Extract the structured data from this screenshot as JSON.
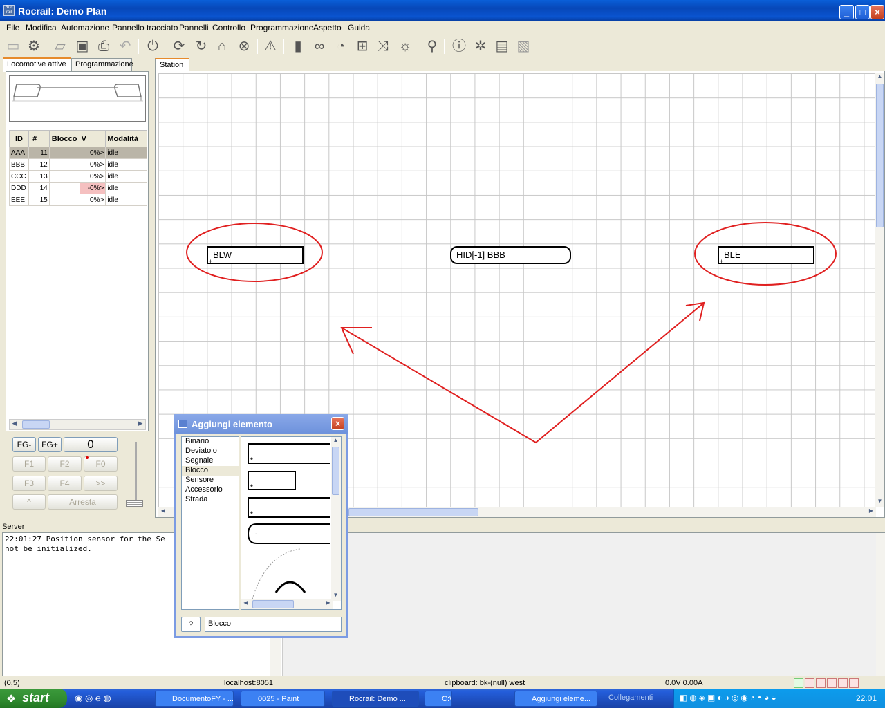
{
  "window": {
    "title": "Rocrail: Demo Plan",
    "app_icon_text": "Roc rail"
  },
  "menu": [
    "File",
    "Modifica",
    "Automazione",
    "Pannello tracciato",
    "Pannelli",
    "Controllo",
    "Programmazione",
    "Aspetto",
    "Guida"
  ],
  "left_tabs": {
    "active": "Locomotive attive",
    "other": "Programmazione"
  },
  "loco_table": {
    "headers": [
      "ID",
      "#__",
      "Blocco",
      "V___",
      "Modalità"
    ],
    "rows": [
      {
        "id": "AAA",
        "num": "11",
        "block": "",
        "v": "0%>",
        "mode": "idle"
      },
      {
        "id": "BBB",
        "num": "12",
        "block": "",
        "v": "0%>",
        "mode": "idle"
      },
      {
        "id": "CCC",
        "num": "13",
        "block": "",
        "v": "0%>",
        "mode": "idle"
      },
      {
        "id": "DDD",
        "num": "14",
        "block": "",
        "v": "-0%>",
        "mode": "idle"
      },
      {
        "id": "EEE",
        "num": "15",
        "block": "",
        "v": "0%>",
        "mode": "idle"
      }
    ]
  },
  "controls": {
    "fg_minus": "FG-",
    "fg_plus": "FG+",
    "speed": "0",
    "f1": "F1",
    "f2": "F2",
    "f0": "F0",
    "f3": "F3",
    "f4": "F4",
    "more": ">>",
    "dir": "^",
    "stop": "Arresta"
  },
  "station_tab": "Station",
  "blocks": {
    "left": "BLW",
    "center": "HID[-1] BBB",
    "right": "BLE"
  },
  "server": {
    "label": "Server",
    "log_line1": "22:01:27 Position sensor for the Se",
    "log_line2": "not be initialized."
  },
  "status": {
    "coords": "(0,5)",
    "host": "localhost:8051",
    "clipboard": "clipboard: bk-(null) west",
    "power": "0.0V 0.00A"
  },
  "taskbar": {
    "start": "start",
    "tasks": [
      "DocumentoFY - ...",
      "0025 - Paint",
      "Rocrail: Demo ...",
      "C:\\",
      "Aggiungi eleme..."
    ],
    "links": "Collegamenti",
    "clock": "22.01"
  },
  "dialog": {
    "title": "Aggiungi elemento",
    "items": [
      "Binario",
      "Deviatoio",
      "Segnale",
      "Blocco",
      "Sensore",
      "Accessorio",
      "Strada"
    ],
    "selected": "Blocco",
    "help": "?",
    "field": "Blocco"
  },
  "colors": {
    "annotation": "#e02020",
    "title_bar": "#0a54d0",
    "tab_highlight": "#e68b2c"
  }
}
